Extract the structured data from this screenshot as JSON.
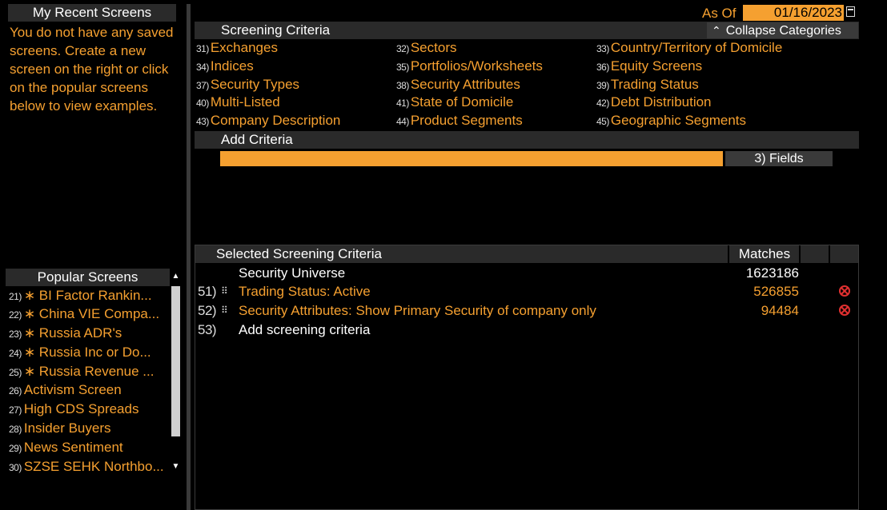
{
  "recent": {
    "header": "My Recent Screens",
    "message": "You do not have any saved screens. Create a new screen on the right or click on the popular screens below to view examples."
  },
  "popular": {
    "header": "Popular Screens",
    "items": [
      {
        "num": "21)",
        "label": "∗ BI Factor Rankin..."
      },
      {
        "num": "22)",
        "label": "∗ China VIE Compa..."
      },
      {
        "num": "23)",
        "label": "∗ Russia ADR's"
      },
      {
        "num": "24)",
        "label": "∗ Russia Inc or Do..."
      },
      {
        "num": "25)",
        "label": "∗ Russia Revenue ..."
      },
      {
        "num": "26)",
        "label": "Activism Screen"
      },
      {
        "num": "27)",
        "label": "High CDS Spreads"
      },
      {
        "num": "28)",
        "label": "Insider Buyers"
      },
      {
        "num": "29)",
        "label": "News Sentiment"
      },
      {
        "num": "30)",
        "label": "SZSE SEHK Northbo..."
      }
    ],
    "scroll_up": "▲",
    "scroll_down": "▼"
  },
  "asof": {
    "label": "As Of",
    "date": "01/16/2023"
  },
  "criteria": {
    "header": "Screening Criteria",
    "collapse_label": "Collapse Categories",
    "collapse_icon": "⌃",
    "items": [
      {
        "num": "31)",
        "label": "Exchanges"
      },
      {
        "num": "32)",
        "label": "Sectors"
      },
      {
        "num": "33)",
        "label": "Country/Territory of Domicile"
      },
      {
        "num": "34)",
        "label": "Indices"
      },
      {
        "num": "35)",
        "label": "Portfolios/Worksheets"
      },
      {
        "num": "36)",
        "label": "Equity Screens"
      },
      {
        "num": "37)",
        "label": "Security Types"
      },
      {
        "num": "38)",
        "label": "Security Attributes"
      },
      {
        "num": "39)",
        "label": "Trading Status"
      },
      {
        "num": "40)",
        "label": "Multi-Listed"
      },
      {
        "num": "41)",
        "label": "State of Domicile"
      },
      {
        "num": "42)",
        "label": "Debt Distribution"
      },
      {
        "num": "43)",
        "label": "Company Description"
      },
      {
        "num": "44)",
        "label": "Product Segments"
      },
      {
        "num": "45)",
        "label": "Geographic Segments"
      }
    ]
  },
  "add": {
    "header": "Add Criteria",
    "fields_button": "3) Fields"
  },
  "selected": {
    "header": "Selected Screening Criteria",
    "matches_header": "Matches",
    "universe_label": "Security Universe",
    "universe_matches": "1623186",
    "rows": [
      {
        "num": "51)",
        "label": "Trading Status: Active",
        "matches": "526855"
      },
      {
        "num": "52)",
        "label": "Security Attributes: Show Primary Security of company only",
        "matches": "94484"
      }
    ],
    "add_row": {
      "num": "53)",
      "label": "Add screening criteria"
    },
    "drag_icon": "⠿"
  },
  "colors": {
    "accent": "#f5a030",
    "header_bg": "#2a2a2a",
    "remove": "#e03030"
  }
}
